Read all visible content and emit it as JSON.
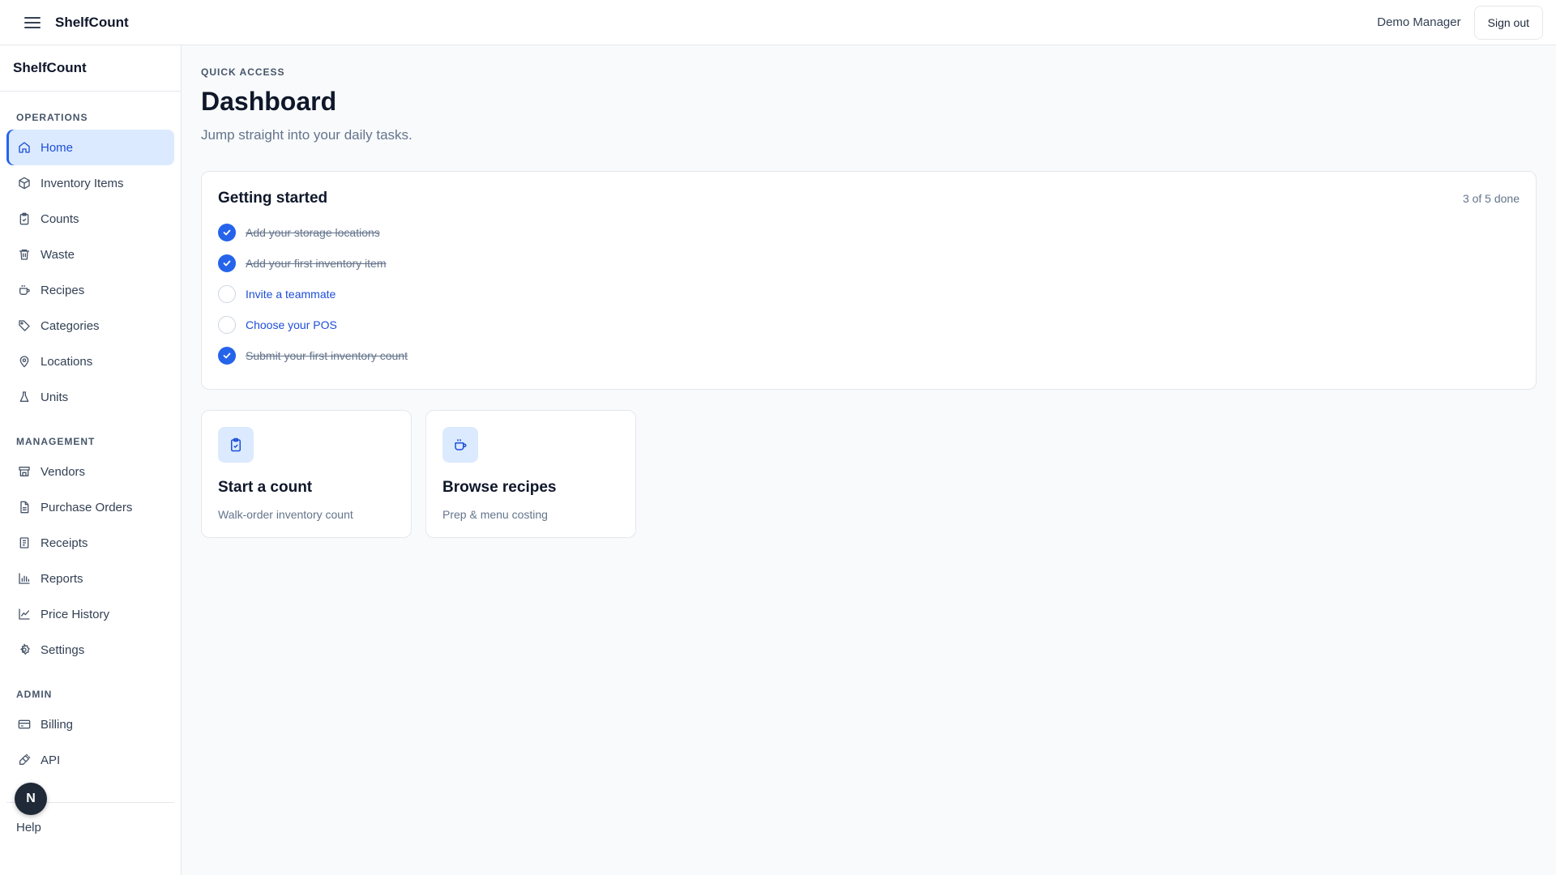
{
  "app": {
    "name": "ShelfCount"
  },
  "topbar": {
    "menu_icon": "hamburger-menu-icon",
    "brand": "ShelfCount",
    "user_name": "Demo Manager",
    "signout_label": "Sign out"
  },
  "sidebar": {
    "brand": "ShelfCount",
    "sections": [
      {
        "label": "OPERATIONS",
        "items": [
          {
            "label": "Home",
            "icon": "home-icon",
            "active": true
          },
          {
            "label": "Inventory Items",
            "icon": "box-icon"
          },
          {
            "label": "Counts",
            "icon": "clipboard-check-icon"
          },
          {
            "label": "Waste",
            "icon": "trash-icon"
          },
          {
            "label": "Recipes",
            "icon": "cup-icon"
          },
          {
            "label": "Categories",
            "icon": "tag-icon"
          },
          {
            "label": "Locations",
            "icon": "map-pin-icon"
          },
          {
            "label": "Units",
            "icon": "flask-icon"
          }
        ]
      },
      {
        "label": "MANAGEMENT",
        "items": [
          {
            "label": "Vendors",
            "icon": "store-icon"
          },
          {
            "label": "Purchase Orders",
            "icon": "file-text-icon"
          },
          {
            "label": "Receipts",
            "icon": "receipt-icon"
          },
          {
            "label": "Reports",
            "icon": "bar-chart-icon"
          },
          {
            "label": "Price History",
            "icon": "line-chart-icon"
          },
          {
            "label": "Settings",
            "icon": "gear-icon"
          }
        ]
      },
      {
        "label": "ADMIN",
        "items": [
          {
            "label": "Billing",
            "icon": "credit-card-icon"
          },
          {
            "label": "API",
            "icon": "plug-icon"
          }
        ]
      }
    ],
    "help_label": "Help",
    "avatar_initial": "N"
  },
  "main": {
    "eyebrow": "QUICK ACCESS",
    "title": "Dashboard",
    "subtitle": "Jump straight into your daily tasks.",
    "getting_started": {
      "title": "Getting started",
      "progress": "3 of 5 done",
      "items": [
        {
          "label": "Add your storage locations",
          "done": true
        },
        {
          "label": "Add your first inventory item",
          "done": true
        },
        {
          "label": "Invite a teammate",
          "done": false
        },
        {
          "label": "Choose your POS",
          "done": false
        },
        {
          "label": "Submit your first inventory count",
          "done": true
        }
      ]
    },
    "actions": [
      {
        "title": "Start a count",
        "description": "Walk-order inventory count",
        "icon": "clipboard-check-icon"
      },
      {
        "title": "Browse recipes",
        "description": "Prep & menu costing",
        "icon": "cup-icon"
      }
    ]
  },
  "colors": {
    "accent": "#2563eb",
    "accent_light": "#dbeafe",
    "link": "#1d4ed8",
    "muted_text": "#64748b",
    "border": "#e5e7eb",
    "background": "#f8fafc"
  }
}
